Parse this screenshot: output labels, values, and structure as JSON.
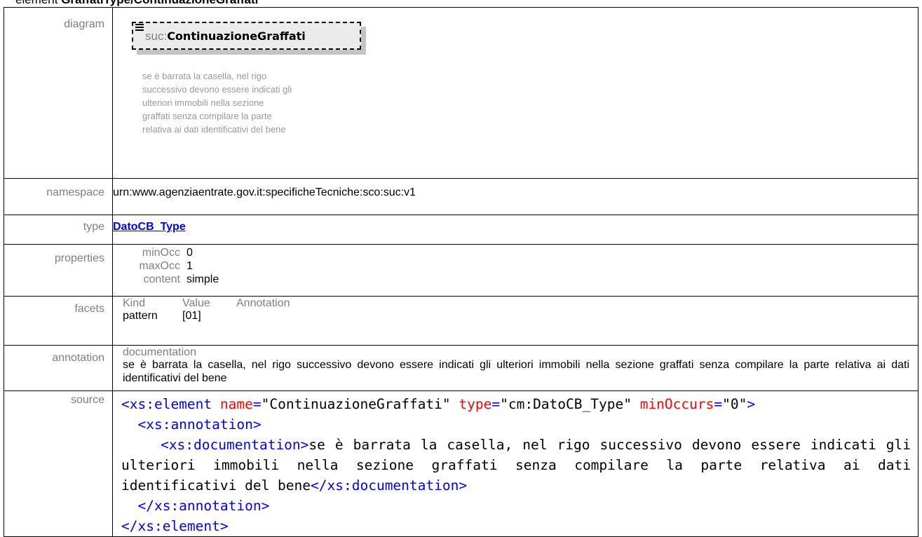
{
  "page": {
    "title_prefix": "element ",
    "title_name": "GraffatiType/ContinuazioneGraffati"
  },
  "rows": {
    "diagram_label": "diagram",
    "namespace_label": "namespace",
    "type_label": "type",
    "properties_label": "properties",
    "facets_label": "facets",
    "annotation_label": "annotation",
    "source_label": "source"
  },
  "diagram": {
    "ns_prefix": "suc:",
    "element_name": "ContinuazioneGraffati",
    "doc_lines": [
      "se è barrata la casella, nel rigo",
      "successivo devono essere indicati gli",
      "ulteriori immobili nella sezione",
      "graffati senza compilare la parte",
      "relativa ai dati identificativi del bene"
    ]
  },
  "namespace": "urn:www.agenziaentrate.gov.it:specificheTecniche:sco:suc:v1",
  "type": "DatoCB_Type",
  "properties": [
    {
      "key": "minOcc",
      "value": "0"
    },
    {
      "key": "maxOcc",
      "value": "1"
    },
    {
      "key": "content",
      "value": "simple"
    }
  ],
  "facets": {
    "headers": [
      "Kind",
      "Value",
      "Annotation"
    ],
    "rows": [
      {
        "kind": "pattern",
        "value": "[01]",
        "annotation": ""
      }
    ]
  },
  "annotation": {
    "heading": "documentation",
    "text": "se è barrata la casella, nel rigo successivo devono essere indicati gli ulteriori immobili nella sezione graffati senza compilare la parte relativa ai dati identificativi del bene"
  },
  "source": {
    "el_open": "<xs:element",
    "attr_name": "name",
    "val_name": "\"ContinuazioneGraffati\"",
    "attr_type": "type",
    "val_type": "\"cm:DatoCB_Type\"",
    "attr_min": "minOccurs",
    "val_min": "\"0\"",
    "gt": ">",
    "eq": "=",
    "ann_open": "<xs:annotation>",
    "doc_open": "<xs:documentation>",
    "doc_text": "se è barrata la casella, nel rigo successivo devono essere indicati gli ulteriori immobili nella sezione graffati senza compilare la parte relativa ai dati identificativi del bene",
    "doc_close": "</xs:documentation>",
    "ann_close": "</xs:annotation>",
    "el_close": "</xs:element>"
  }
}
